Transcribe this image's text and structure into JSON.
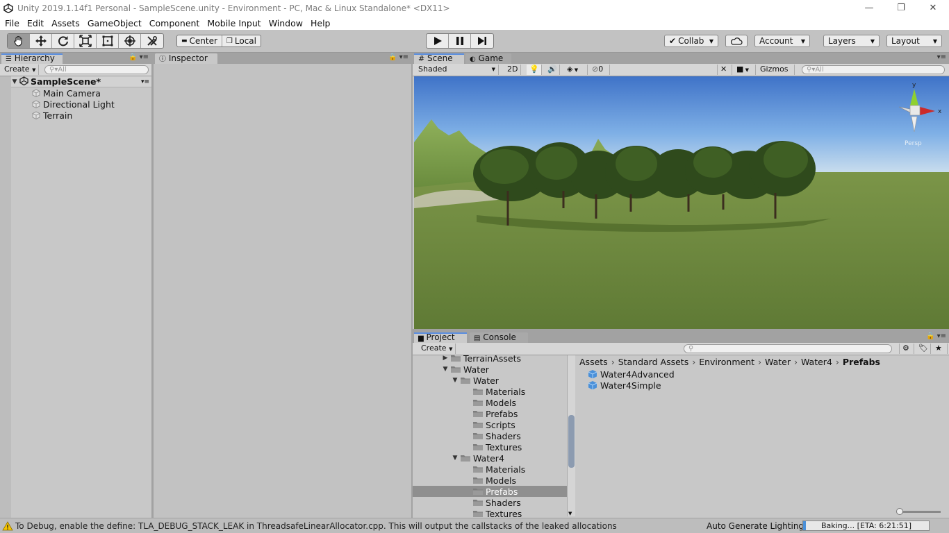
{
  "window": {
    "title": "Unity 2019.1.14f1 Personal - SampleScene.unity - Environment - PC, Mac & Linux Standalone* <DX11>",
    "minimize": "—",
    "restore": "❐",
    "close": "✕"
  },
  "menu": [
    "File",
    "Edit",
    "Assets",
    "GameObject",
    "Component",
    "Mobile Input",
    "Window",
    "Help"
  ],
  "toolbar": {
    "pivot_center": "Center",
    "pivot_local": "Local",
    "collab": "Collab",
    "account": "Account",
    "layers": "Layers",
    "layout": "Layout"
  },
  "hierarchy": {
    "tab": "Hierarchy",
    "create": "Create",
    "search_placeholder": "All",
    "scene": "SampleScene*",
    "items": [
      "Main Camera",
      "Directional Light",
      "Terrain"
    ]
  },
  "inspector": {
    "tab": "Inspector"
  },
  "scene": {
    "tab_scene": "Scene",
    "tab_game": "Game",
    "shading": "Shaded",
    "mode_2d": "2D",
    "hidden_count": "0",
    "gizmos": "Gizmos",
    "search_placeholder": "All",
    "axis_x": "x",
    "axis_y": "y",
    "projection": "Persp"
  },
  "project": {
    "tab_project": "Project",
    "tab_console": "Console",
    "create": "Create",
    "tree": [
      {
        "label": "TerrainAssets",
        "level": 0,
        "arrow": "right"
      },
      {
        "label": "Water",
        "level": 0,
        "arrow": "down"
      },
      {
        "label": "Water",
        "level": 1,
        "arrow": "down"
      },
      {
        "label": "Materials",
        "level": 2,
        "arrow": ""
      },
      {
        "label": "Models",
        "level": 2,
        "arrow": ""
      },
      {
        "label": "Prefabs",
        "level": 2,
        "arrow": ""
      },
      {
        "label": "Scripts",
        "level": 2,
        "arrow": ""
      },
      {
        "label": "Shaders",
        "level": 2,
        "arrow": ""
      },
      {
        "label": "Textures",
        "level": 2,
        "arrow": ""
      },
      {
        "label": "Water4",
        "level": 1,
        "arrow": "down"
      },
      {
        "label": "Materials",
        "level": 2,
        "arrow": ""
      },
      {
        "label": "Models",
        "level": 2,
        "arrow": ""
      },
      {
        "label": "Prefabs",
        "level": 2,
        "arrow": "",
        "selected": true
      },
      {
        "label": "Shaders",
        "level": 2,
        "arrow": ""
      },
      {
        "label": "Textures",
        "level": 2,
        "arrow": ""
      }
    ],
    "breadcrumb": [
      "Assets",
      "Standard Assets",
      "Environment",
      "Water",
      "Water4",
      "Prefabs"
    ],
    "assets": [
      "Water4Advanced",
      "Water4Simple"
    ]
  },
  "status": {
    "message": "To Debug, enable the define: TLA_DEBUG_STACK_LEAK in ThreadsafeLinearAllocator.cpp. This will output the callstacks of the leaked allocations",
    "lighting": "Auto Generate Lighting On",
    "baking": "Baking... [ETA: 6:21:51]",
    "baking_progress": 0.02
  },
  "colors": {
    "accent": "#5a8ee0",
    "selection": "#8f8f8f",
    "sky_top": "#3f73c8",
    "grass": "#6e8a42",
    "warning": "#f5c400"
  }
}
